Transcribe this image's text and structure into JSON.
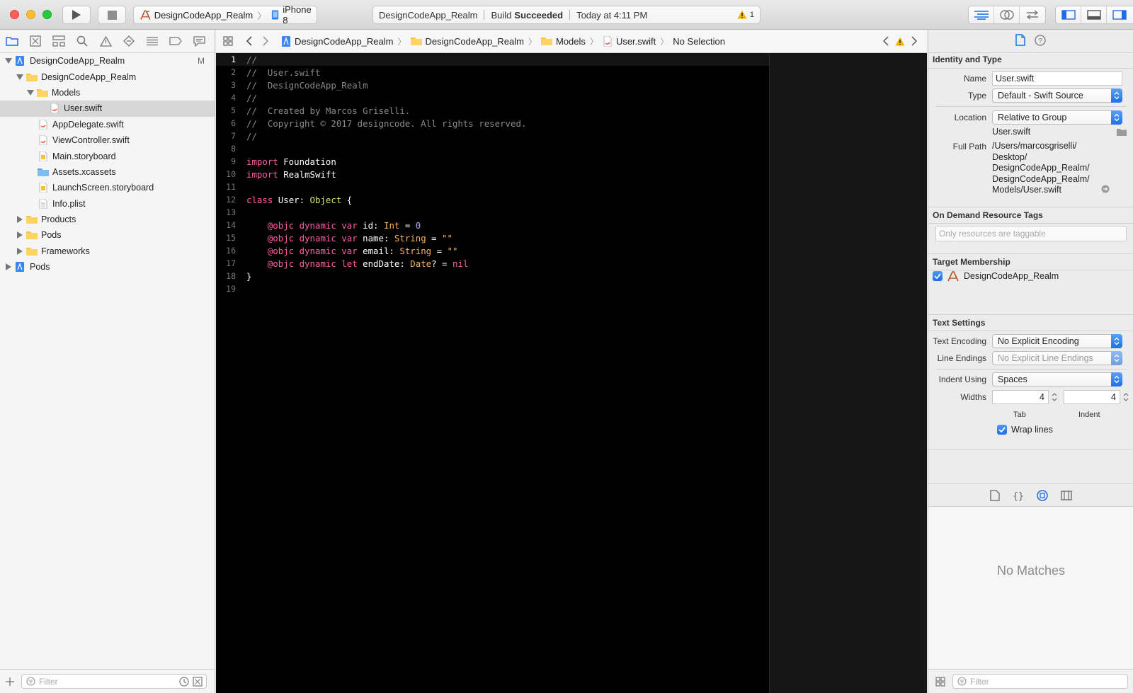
{
  "toolbar": {
    "scheme_name": "DesignCodeApp_Realm",
    "device": "iPhone 8",
    "activity_project": "DesignCodeApp_Realm",
    "activity_status_prefix": "Build",
    "activity_status": "Succeeded",
    "activity_time": "Today at 4:11 PM",
    "warning_count": "1"
  },
  "navigator": {
    "items": [
      {
        "label": "DesignCodeApp_Realm",
        "badge": "M"
      },
      {
        "label": "DesignCodeApp_Realm"
      },
      {
        "label": "Models"
      },
      {
        "label": "User.swift"
      },
      {
        "label": "AppDelegate.swift"
      },
      {
        "label": "ViewController.swift"
      },
      {
        "label": "Main.storyboard"
      },
      {
        "label": "Assets.xcassets"
      },
      {
        "label": "LaunchScreen.storyboard"
      },
      {
        "label": "Info.plist"
      },
      {
        "label": "Products"
      },
      {
        "label": "Pods"
      },
      {
        "label": "Frameworks"
      },
      {
        "label": "Pods"
      }
    ],
    "filter_placeholder": "Filter"
  },
  "jumpbar": {
    "crumbs": [
      "DesignCodeApp_Realm",
      "DesignCodeApp_Realm",
      "Models",
      "User.swift",
      "No Selection"
    ]
  },
  "editor": {
    "line_numbers": [
      "1",
      "2",
      "3",
      "4",
      "5",
      "6",
      "7",
      "8",
      "9",
      "10",
      "11",
      "12",
      "13",
      "14",
      "15",
      "16",
      "17",
      "18",
      "19"
    ],
    "lines": {
      "l1": "//",
      "l2": "//  User.swift",
      "l3": "//  DesignCodeApp_Realm",
      "l4": "//",
      "l5": "//  Created by Marcos Griselli.",
      "l6": "//  Copyright © 2017 designcode. All rights reserved.",
      "l7": "//",
      "kw_import": "import",
      "l9_mod": " Foundation",
      "l10_mod": " RealmSwift",
      "kw_class": "class",
      "l12_name": " User: ",
      "l12_super": "Object",
      "l12_brace": " {",
      "attr": "    @objc",
      "kw_dynamic": " dynamic",
      "kw_var": " var",
      "kw_let": " let",
      "l14_id": " id: ",
      "t_int": "Int",
      "eq": " = ",
      "n_zero": "0",
      "l15_name": " name: ",
      "t_string": "String",
      "s_empty": "\"\"",
      "l16_email": " email: ",
      "l17_end": " endDate: ",
      "t_date": "Date",
      "q_eq": "? = ",
      "k_nil": "nil",
      "l18": "}"
    }
  },
  "inspector": {
    "identity_title": "Identity and Type",
    "name_label": "Name",
    "name_value": "User.swift",
    "type_label": "Type",
    "type_value": "Default - Swift Source",
    "location_label": "Location",
    "location_value": "Relative to Group",
    "location_file": "User.swift",
    "fullpath_label": "Full Path",
    "fullpath_lines": [
      "/Users/marcosgriselli/",
      "Desktop/",
      "DesignCodeApp_Realm/",
      "DesignCodeApp_Realm/",
      "Models/User.swift"
    ],
    "ondemand_title": "On Demand Resource Tags",
    "ondemand_placeholder": "Only resources are taggable",
    "target_title": "Target Membership",
    "target_name": "DesignCodeApp_Realm",
    "text_title": "Text Settings",
    "encoding_label": "Text Encoding",
    "encoding_value": "No Explicit Encoding",
    "line_endings_label": "Line Endings",
    "line_endings_value": "No Explicit Line Endings",
    "indent_label": "Indent Using",
    "indent_value": "Spaces",
    "widths_label": "Widths",
    "tab_value": "4",
    "indent_width_value": "4",
    "tab_caption": "Tab",
    "indent_caption": "Indent",
    "wrap_label": "Wrap lines",
    "no_matches": "No Matches",
    "filter_placeholder": "Filter"
  },
  "colors": {
    "accent": "#1e6de5",
    "editor_bg": "#000000",
    "keyword": "#fc5fa3",
    "type": "#fdb05c",
    "class_name": "#d0e66c",
    "number": "#b4a6ff",
    "comment": "#8a8a8a"
  }
}
